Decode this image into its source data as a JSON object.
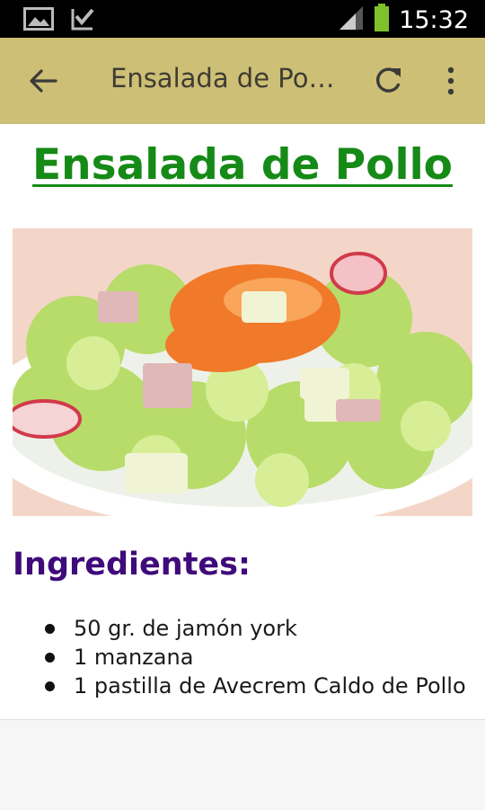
{
  "status_bar": {
    "time": "15:32"
  },
  "app_bar": {
    "title": "Ensalada de Po…"
  },
  "recipe": {
    "title": "Ensalada de Pollo",
    "ingredients_heading": "Ingredientes:",
    "ingredients": [
      "50 gr. de jamón york",
      "1 manzana",
      "1 pastilla de Avecrem Caldo de Pollo"
    ]
  },
  "colors": {
    "app_bar": "#cdbf75",
    "title_green": "#168a16",
    "heading_purple": "#3f0a7a"
  },
  "icons": [
    "gallery-icon",
    "download-done-icon",
    "signal-icon",
    "battery-icon",
    "back-arrow-icon",
    "refresh-icon",
    "more-vert-icon"
  ]
}
